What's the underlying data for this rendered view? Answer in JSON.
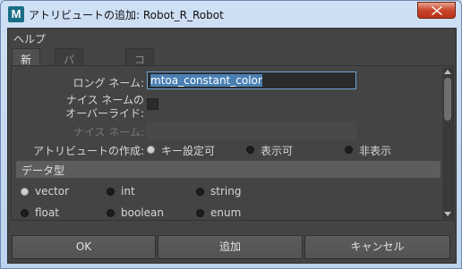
{
  "window": {
    "title": "アトリビュートの追加: Robot_R_Robot",
    "app_icon_letter": "M"
  },
  "menu": {
    "help": "ヘルプ"
  },
  "tabs": [
    {
      "label": "新規",
      "active": true
    },
    {
      "label": "パーティクル",
      "active": false
    },
    {
      "label": "コントロール",
      "active": false
    }
  ],
  "form": {
    "long_name_label": "ロング ネーム:",
    "long_name_value": "mtoa_constant_color",
    "nice_name_override_label_line1": "ナイス ネームの",
    "nice_name_override_label_line2": "オーバーライド:",
    "nice_name_label": "ナイス ネーム:",
    "nice_name_value": "",
    "make_attribute_label": "アトリビュートの作成:",
    "make_attribute_options": [
      "キー設定可",
      "表示可",
      "非表示"
    ],
    "make_attribute_selected": "キー設定可"
  },
  "data_type": {
    "header": "データ型",
    "options": [
      "vector",
      "int",
      "string",
      "float",
      "boolean",
      "enum"
    ],
    "selected": "vector"
  },
  "buttons": {
    "ok": "OK",
    "add": "追加",
    "cancel": "キャンセル"
  }
}
